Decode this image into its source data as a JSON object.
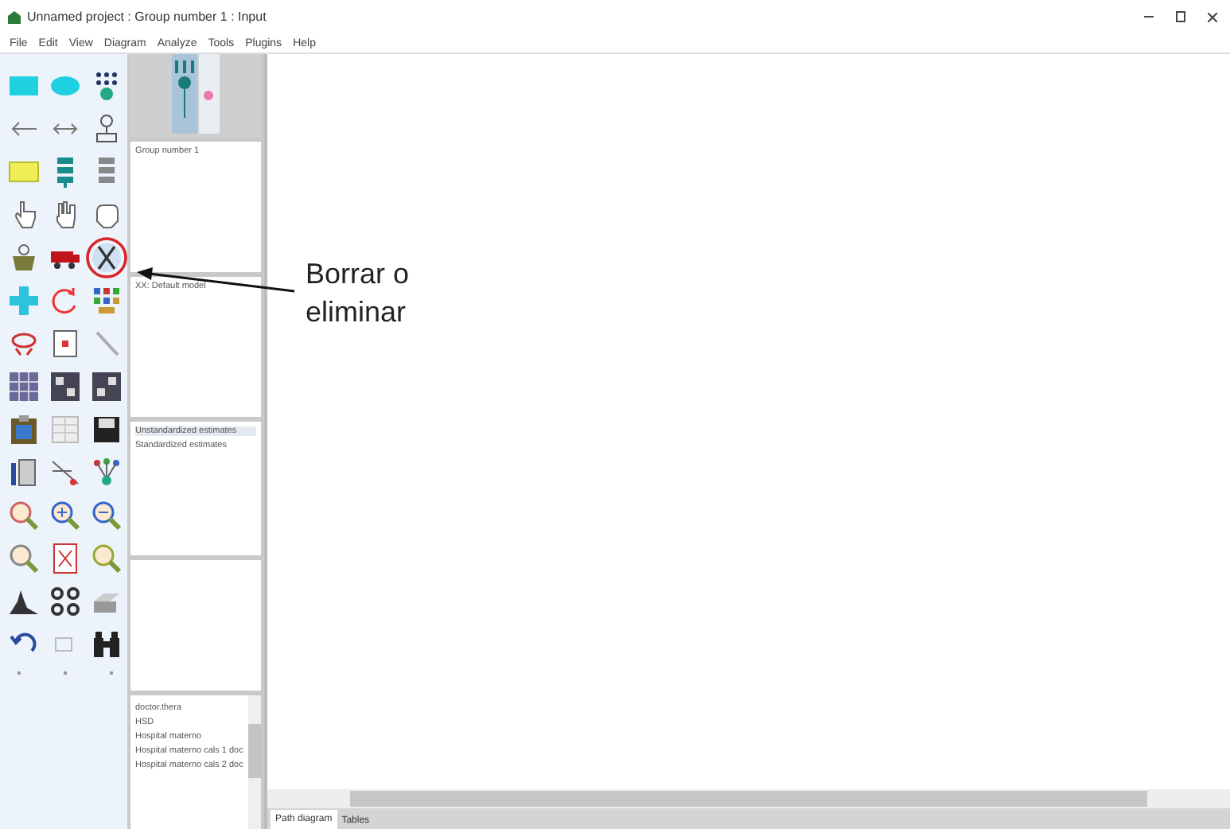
{
  "window": {
    "title": "Unnamed project : Group number 1 : Input"
  },
  "menu": [
    "File",
    "Edit",
    "View",
    "Diagram",
    "Analyze",
    "Tools",
    "Plugins",
    "Help"
  ],
  "groups": [
    "Group number 1"
  ],
  "models": [
    "XX: Default model"
  ],
  "estimates": [
    {
      "label": "Unstandardized estimates",
      "selected": true
    },
    {
      "label": "Standardized estimates",
      "selected": false
    }
  ],
  "files": [
    "doctor.thera",
    "HSD",
    "Hospital materno",
    "Hospital materno cals 1 doc",
    "Hospital materno cals 2 doc"
  ],
  "tabs": [
    {
      "label": "Path diagram",
      "selected": true
    },
    {
      "label": "Tables",
      "selected": false
    }
  ],
  "annotation": {
    "text": "Borrar o eliminar"
  }
}
